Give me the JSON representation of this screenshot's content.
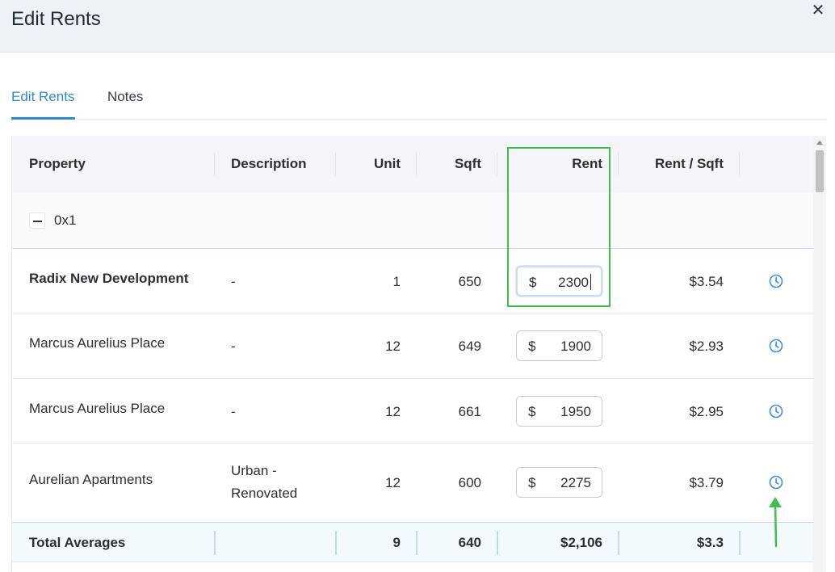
{
  "dialog": {
    "title": "Edit Rents",
    "close_glyph": "✕"
  },
  "tabs": [
    {
      "label": "Edit Rents",
      "active": true
    },
    {
      "label": "Notes",
      "active": false
    }
  ],
  "columns": {
    "property": "Property",
    "description": "Description",
    "unit": "Unit",
    "sqft": "Sqft",
    "rent": "Rent",
    "rent_per_sqft": "Rent / Sqft"
  },
  "group": {
    "label": "0x1",
    "expanded": true
  },
  "rows": [
    {
      "property": "Radix New Development",
      "description": "-",
      "description_line2": "",
      "unit": "1",
      "sqft": "650",
      "currency": "$",
      "rent": "2300",
      "rent_per_sqft": "$3.54",
      "highlight": true
    },
    {
      "property": "Marcus Aurelius Place",
      "description": "-",
      "description_line2": "",
      "unit": "12",
      "sqft": "649",
      "currency": "$",
      "rent": "1900",
      "rent_per_sqft": "$2.93",
      "highlight": false
    },
    {
      "property": "Marcus Aurelius Place",
      "description": "-",
      "description_line2": "",
      "unit": "12",
      "sqft": "661",
      "currency": "$",
      "rent": "1950",
      "rent_per_sqft": "$2.95",
      "highlight": false
    },
    {
      "property": "Aurelian Apartments",
      "description": "Urban -",
      "description_line2": "Renovated",
      "unit": "12",
      "sqft": "600",
      "currency": "$",
      "rent": "2275",
      "rent_per_sqft": "$3.79",
      "highlight": false
    }
  ],
  "totals": {
    "label": "Total Averages",
    "unit": "9",
    "sqft": "640",
    "rent": "$2,106",
    "rent_per_sqft": "$3.3"
  },
  "icons": {
    "history": "clock-icon",
    "close": "close-icon",
    "collapse": "minus-icon"
  },
  "colors": {
    "accent": "#2e8ad8",
    "annotation": "#3fbf4f",
    "header_bg": "#eef1f6",
    "total_bg": "#f3fafd"
  }
}
